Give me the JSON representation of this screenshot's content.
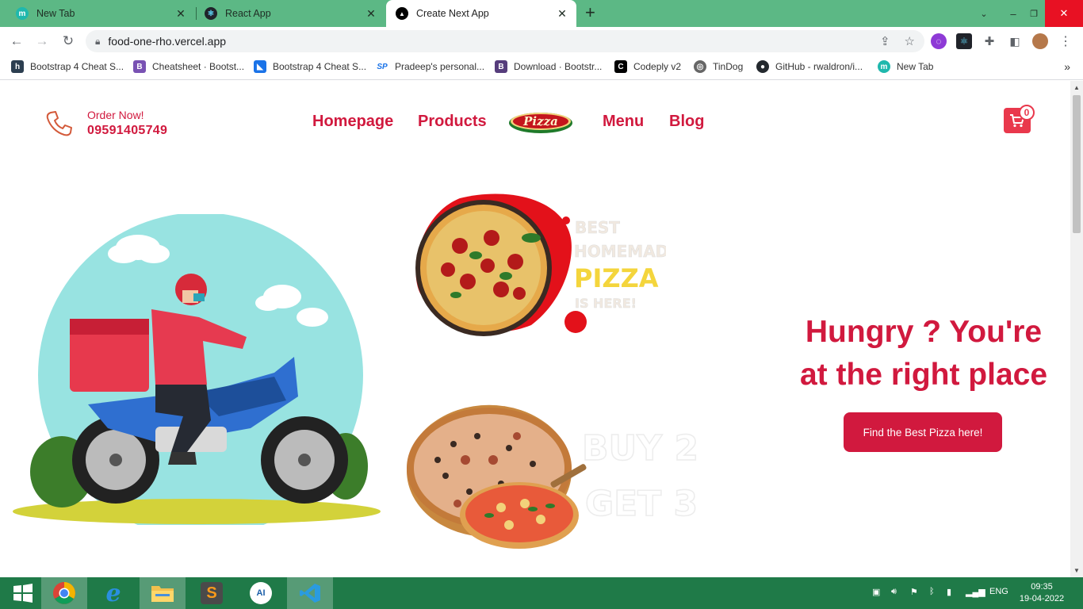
{
  "browser": {
    "tabs": [
      {
        "title": "New Tab",
        "icon": "m-icon"
      },
      {
        "title": "React App",
        "icon": "react-icon"
      },
      {
        "title": "Create Next App",
        "icon": "nextjs-icon"
      }
    ],
    "url": "food-one-rho.vercel.app",
    "bookmarks": [
      {
        "label": "Bootstrap 4 Cheat S...",
        "icon": "h",
        "color": "#2c3e50"
      },
      {
        "label": "Cheatsheet · Bootst...",
        "icon": "B",
        "color": "#7952b3"
      },
      {
        "label": "Bootstrap 4 Cheat S...",
        "icon": "",
        "color": "#1a73e8"
      },
      {
        "label": "Pradeep's personal...",
        "icon": "SP",
        "color": "#1a73e8"
      },
      {
        "label": "Download · Bootstr...",
        "icon": "B",
        "color": "#563d7c"
      },
      {
        "label": "Codeply v2",
        "icon": "C",
        "color": "#000000"
      },
      {
        "label": "TinDog",
        "icon": "",
        "color": "#555555"
      },
      {
        "label": "GitHub - rwaldron/i...",
        "icon": "",
        "color": "#24292e"
      },
      {
        "label": "New Tab",
        "icon": "m",
        "color": "#1fb8ad"
      }
    ]
  },
  "site": {
    "order_label": "Order Now!",
    "phone": "09591405749",
    "nav": [
      "Homepage",
      "Products",
      "Menu",
      "Blog"
    ],
    "logo_text": "Pizza",
    "cart_count": "0",
    "promo1": {
      "line1": "BEST",
      "line2": "HOMEMADE",
      "line3": "PIZZA",
      "line4": "IS HERE!"
    },
    "promo2": {
      "line1": "BUY 2",
      "line2": "GET 3"
    },
    "hero_title_line1": "Hungry ? You're",
    "hero_title_line2": "at the right place",
    "hero_button": "Find the Best Pizza here!",
    "brand_color": "#d1193e"
  },
  "taskbar": {
    "language": "ENG",
    "time": "09:35",
    "date": "19-04-2022"
  }
}
